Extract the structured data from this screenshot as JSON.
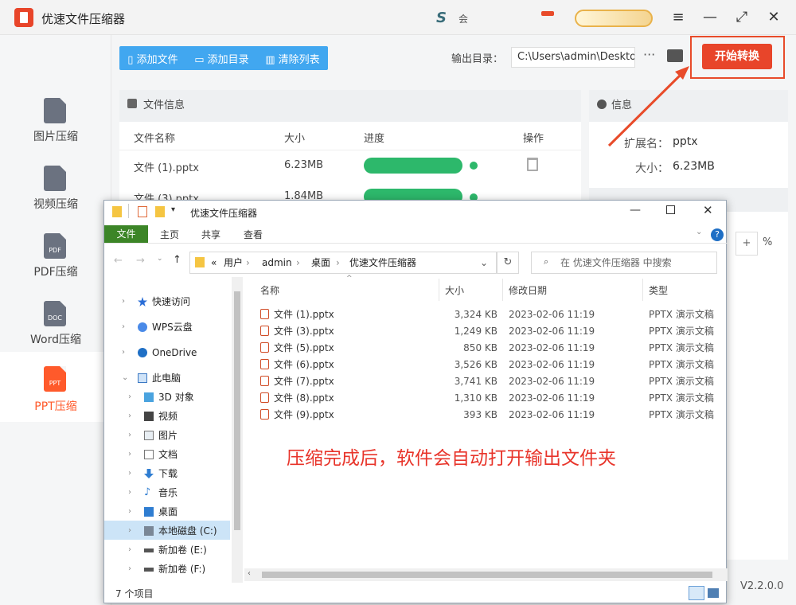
{
  "app": {
    "title": "优速文件压缩器",
    "brand_mark": "S",
    "member_text": "会",
    "version": "V2.2.0.0"
  },
  "window_controls": {
    "menu": "≡",
    "minimize": "—",
    "maximize": "⤢",
    "close": "✕"
  },
  "sidebar": {
    "items": [
      {
        "label": "图片压缩",
        "icon_text": ""
      },
      {
        "label": "视频压缩",
        "icon_text": ""
      },
      {
        "label": "PDF压缩",
        "icon_text": "PDF"
      },
      {
        "label": "Word压缩",
        "icon_text": "DOC"
      },
      {
        "label": "PPT压缩",
        "icon_text": "PPT",
        "active": true
      }
    ]
  },
  "toolbar": {
    "add_file": "添加文件",
    "add_dir": "添加目录",
    "clear_list": "清除列表"
  },
  "output": {
    "label": "输出目录：",
    "path": "C:\\Users\\admin\\Deskto",
    "more": "···"
  },
  "start_button": "开始转换",
  "file_panel": {
    "title": "文件信息",
    "columns": {
      "name": "文件名称",
      "size": "大小",
      "progress": "进度",
      "action": "操作"
    },
    "rows": [
      {
        "name": "文件 (1).pptx",
        "size": "6.23MB",
        "progress": 1.0
      },
      {
        "name": "文件 (3).pptx",
        "size": "1.84MB",
        "progress": 1.0
      }
    ]
  },
  "info_panel": {
    "title": "信息",
    "ext_label": "扩展名：",
    "ext_value": "pptx",
    "size_label": "大小：",
    "size_value": "6.23MB",
    "percent": "%"
  },
  "explorer": {
    "title": "优速文件压缩器",
    "ribbon": {
      "file": "文件",
      "home": "主页",
      "share": "共享",
      "view": "查看"
    },
    "address": {
      "p1": "用户",
      "p2": "admin",
      "p3": "桌面",
      "p4": "优速文件压缩器",
      "lead": "«"
    },
    "search_placeholder": "在 优速文件压缩器 中搜索",
    "nav": {
      "quick_access": "快速访问",
      "wps": "WPS云盘",
      "onedrive": "OneDrive",
      "this_pc": "此电脑",
      "objects3d": "3D 对象",
      "videos": "视频",
      "pictures": "图片",
      "documents": "文档",
      "downloads": "下载",
      "music": "音乐",
      "desktop": "桌面",
      "local_c": "本地磁盘 (C:)",
      "vol_e": "新加卷 (E:)",
      "vol_f": "新加卷 (F:)"
    },
    "columns": {
      "name": "名称",
      "size": "大小",
      "modified": "修改日期",
      "type": "类型"
    },
    "files": [
      {
        "name": "文件 (1).pptx",
        "size": "3,324 KB",
        "date": "2023-02-06 11:19",
        "type": "PPTX 演示文稿"
      },
      {
        "name": "文件 (3).pptx",
        "size": "1,249 KB",
        "date": "2023-02-06 11:19",
        "type": "PPTX 演示文稿"
      },
      {
        "name": "文件 (5).pptx",
        "size": "850 KB",
        "date": "2023-02-06 11:19",
        "type": "PPTX 演示文稿"
      },
      {
        "name": "文件 (6).pptx",
        "size": "3,526 KB",
        "date": "2023-02-06 11:19",
        "type": "PPTX 演示文稿"
      },
      {
        "name": "文件 (7).pptx",
        "size": "3,741 KB",
        "date": "2023-02-06 11:19",
        "type": "PPTX 演示文稿"
      },
      {
        "name": "文件 (8).pptx",
        "size": "1,310 KB",
        "date": "2023-02-06 11:19",
        "type": "PPTX 演示文稿"
      },
      {
        "name": "文件 (9).pptx",
        "size": "393 KB",
        "date": "2023-02-06 11:19",
        "type": "PPTX 演示文稿"
      }
    ],
    "status": "7 个项目"
  },
  "annotation": "压缩完成后，软件会自动打开输出文件夹",
  "colors": {
    "accent": "#e8452a",
    "toolbar_blue": "#41a7f0",
    "progress_green": "#2db86b",
    "explorer_file_tab": "#3c8527"
  }
}
